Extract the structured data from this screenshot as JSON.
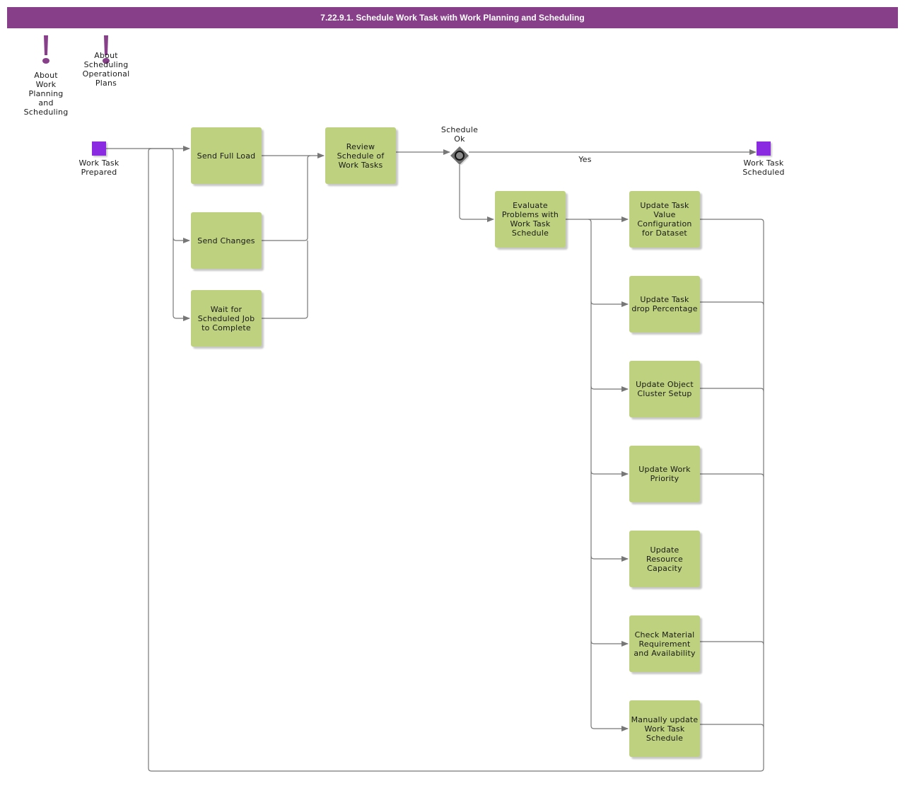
{
  "title": "7.22.9.1. Schedule Work Task with Work Planning and Scheduling",
  "colors": {
    "title_bar": "#873f8a",
    "task_fill": "#bdd17e",
    "event_fill": "#8a2be2",
    "annotation_icon": "#873f8a",
    "gateway_fill": "#6f6f6f",
    "connector": "#777777"
  },
  "annotations": [
    {
      "icon": "exclamation-icon",
      "label": "About\nWork\nPlanning\nand\nScheduling"
    },
    {
      "icon": "exclamation-icon",
      "label": "About\nScheduling\nOperational\nPlans"
    }
  ],
  "events": {
    "start": {
      "label": "Work Task\nPrepared"
    },
    "end": {
      "label": "Work Task\nScheduled"
    }
  },
  "gateway": {
    "label": "Schedule\nOk",
    "type": "event-based-gateway",
    "yes_label": "Yes"
  },
  "tasks": {
    "send_full_load": "Send Full Load",
    "send_changes": "Send Changes",
    "wait_job": "Wait for\nScheduled Job\nto Complete",
    "review": "Review\nSchedule of\nWork Tasks",
    "evaluate": "Evaluate\nProblems with\nWork Task\nSchedule",
    "update_value_config": "Update Task\nValue\nConfiguration\nfor Dataset",
    "update_drop_pct": "Update Task\ndrop Percentage",
    "update_cluster": "Update Object\nCluster Setup",
    "update_priority": "Update Work\nPriority",
    "update_capacity": "Update\nResource\nCapacity",
    "check_material": "Check Material\nRequirement\nand Availability",
    "manual_update": "Manually update\nWork Task\nSchedule"
  }
}
